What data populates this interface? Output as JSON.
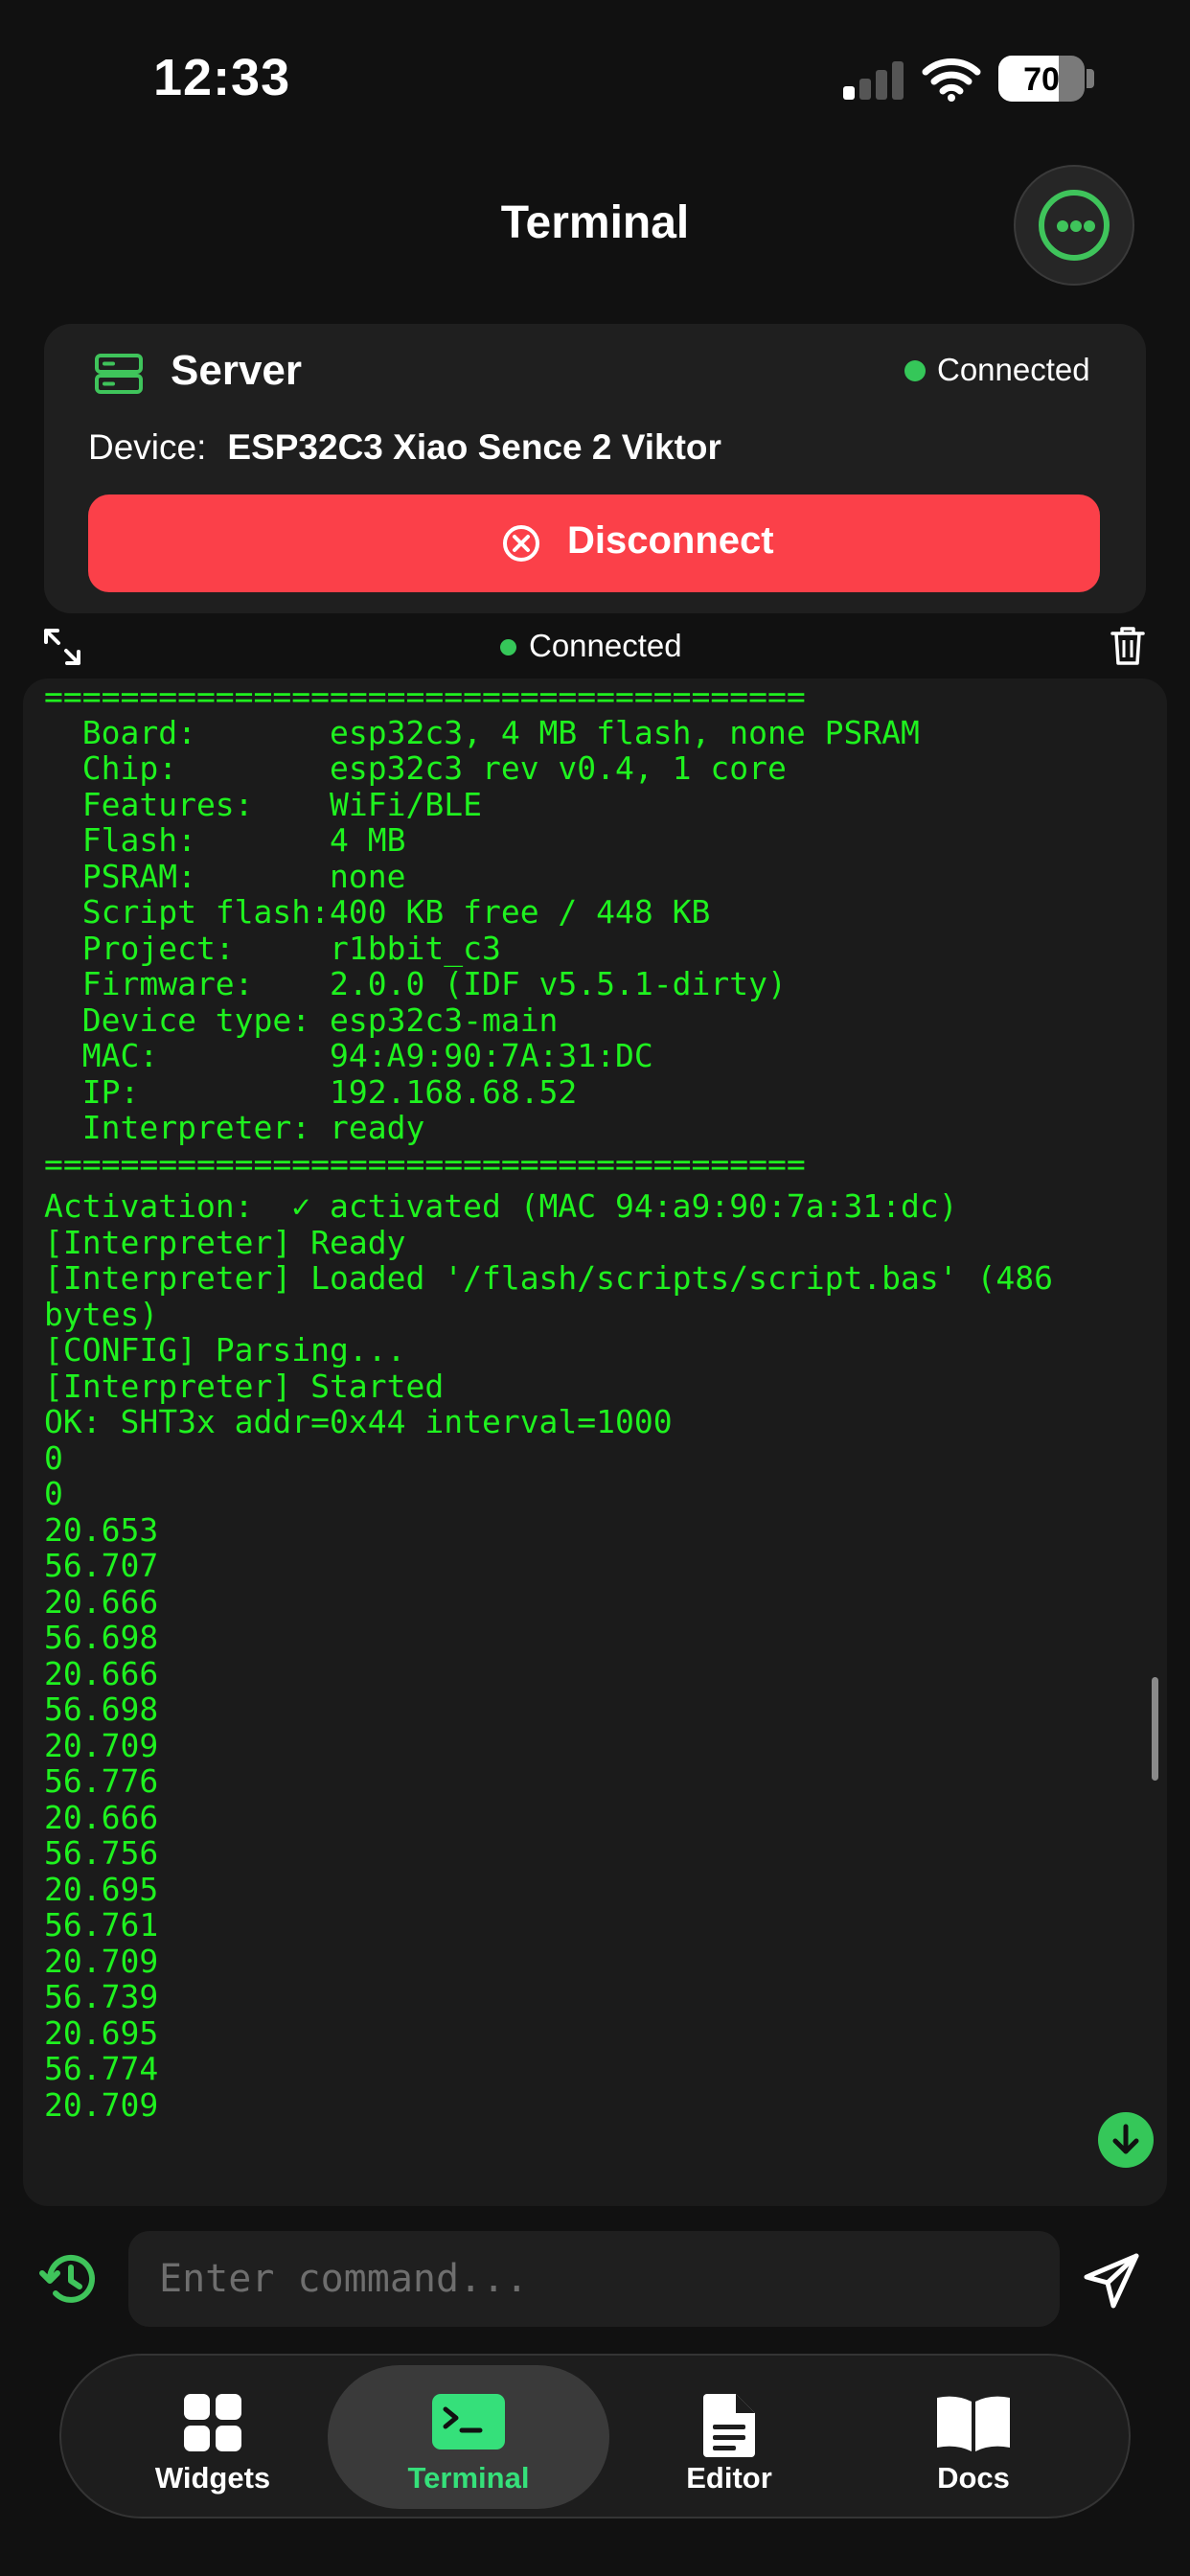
{
  "status_bar": {
    "time": "12:33",
    "battery_level": "70",
    "battery_fraction": 0.7
  },
  "header": {
    "title": "Terminal"
  },
  "server_card": {
    "title": "Server",
    "status": "Connected",
    "device_label": "Device:",
    "device_name": "ESP32C3 Xiao Sence 2 Viktor",
    "disconnect_label": "Disconnect"
  },
  "terminal_toolbar": {
    "status": "Connected"
  },
  "terminal": {
    "lines": [
      "========================================",
      "  Board:       esp32c3, 4 MB flash, none PSRAM",
      "  Chip:        esp32c3 rev v0.4, 1 core",
      "  Features:    WiFi/BLE",
      "  Flash:       4 MB",
      "  PSRAM:       none",
      "  Script flash:400 KB free / 448 KB",
      "  Project:     r1bbit_c3",
      "  Firmware:    2.0.0 (IDF v5.5.1-dirty)",
      "  Device type: esp32c3-main",
      "  MAC:         94:A9:90:7A:31:DC",
      "  IP:          192.168.68.52",
      "  Interpreter: ready",
      "========================================",
      "Activation:  ✓ activated (MAC 94:a9:90:7a:31:dc)",
      "[Interpreter] Ready",
      "[Interpreter] Loaded '/flash/scripts/script.bas' (486",
      "bytes)",
      "[CONFIG] Parsing...",
      "[Interpreter] Started",
      "OK: SHT3x addr=0x44 interval=1000",
      "0",
      "0",
      "20.653",
      "56.707",
      "20.666",
      "56.698",
      "20.666",
      "56.698",
      "20.709",
      "56.776",
      "20.666",
      "56.756",
      "20.695",
      "56.761",
      "20.709",
      "56.739",
      "20.695",
      "56.774",
      "20.709"
    ]
  },
  "command_bar": {
    "placeholder": "Enter command..."
  },
  "tabs": [
    {
      "label": "Widgets",
      "icon": "widgets-grid-icon"
    },
    {
      "label": "Terminal",
      "icon": "terminal-icon",
      "active": true
    },
    {
      "label": "Editor",
      "icon": "document-icon"
    },
    {
      "label": "Docs",
      "icon": "book-icon"
    }
  ],
  "colors": {
    "accent_green": "#35c759",
    "terminal_text": "#1ff21f",
    "disconnect_red": "#fb4049",
    "active_tab_label": "#35e07a"
  }
}
